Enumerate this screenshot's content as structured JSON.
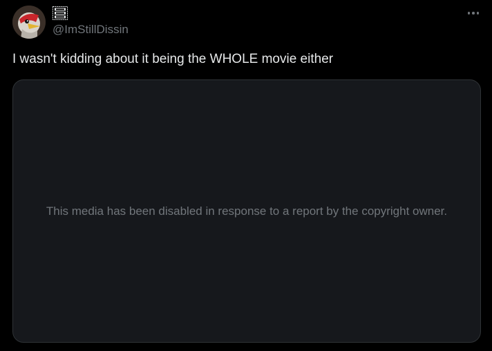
{
  "tweet": {
    "avatar_icon": "avatar-bird-icon",
    "display_name_logo_text": "NULL NOTE HEAD",
    "handle": "@ImStillDissin",
    "more_icon": "more-horizontal-icon",
    "text": "I wasn't kidding about it being the WHOLE movie either",
    "media_notice": "This media has been disabled in response to a report by the copyright owner."
  },
  "colors": {
    "background": "#000000",
    "primary_text": "#e7e9ea",
    "secondary_text": "#71767b",
    "media_background": "#16181c",
    "border": "#2f3336"
  }
}
